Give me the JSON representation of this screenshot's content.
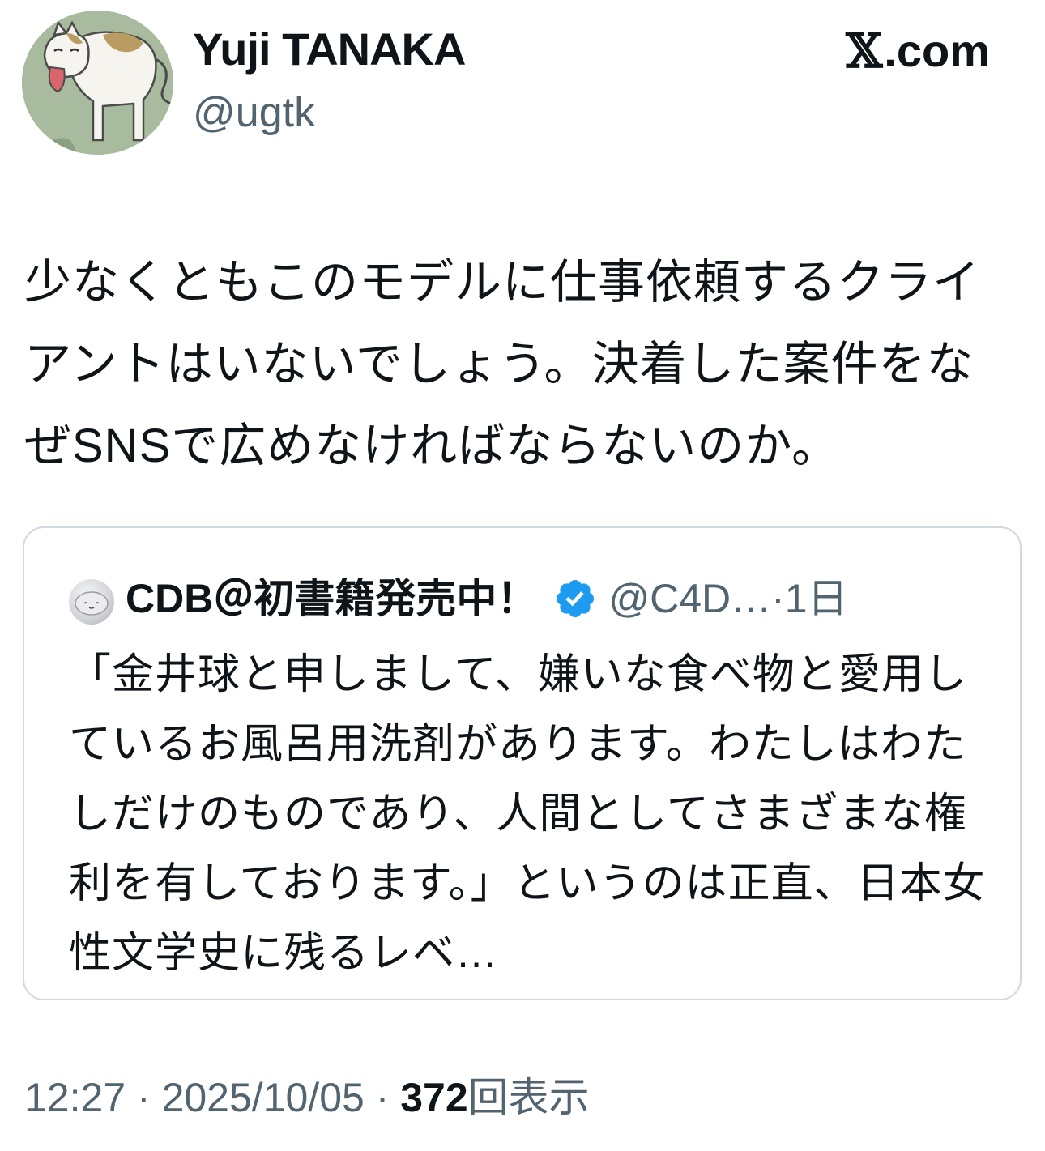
{
  "author": {
    "display_name": "Yuji TANAKA",
    "handle": "@ugtk"
  },
  "brand": {
    "site": ".com",
    "x_glyph": "𝕏",
    "icon": "x-logo-icon"
  },
  "tweet": {
    "text": "少なくともこのモデルに仕事依頼するクライアントはいないでしょう。決着した案件をなぜSNSで広めなければならないのか。"
  },
  "quote": {
    "name": "CDB＠初書籍発売中！",
    "verified_icon": "verified-badge-icon",
    "handle": "@C4D…",
    "separator": "·",
    "time": "1日",
    "text": "「金井球と申しまして、嫌いな食べ物と愛用しているお風呂用洗剤があります。わたしはわたしだけのものであり、人間としてさまざまな権利を有しております。」というのは正直、日本女性文学史に残るレベ…"
  },
  "footer": {
    "time": "12:27",
    "sep1": " · ",
    "date": "2025/10/05",
    "sep2": " · ",
    "views": "372",
    "views_label": "回表示"
  },
  "colors": {
    "text": "#0f1419",
    "secondary": "#536471",
    "border": "#cfd9de",
    "verified": "#1d9bf0",
    "avatar_bg": "#a9bb9f"
  }
}
